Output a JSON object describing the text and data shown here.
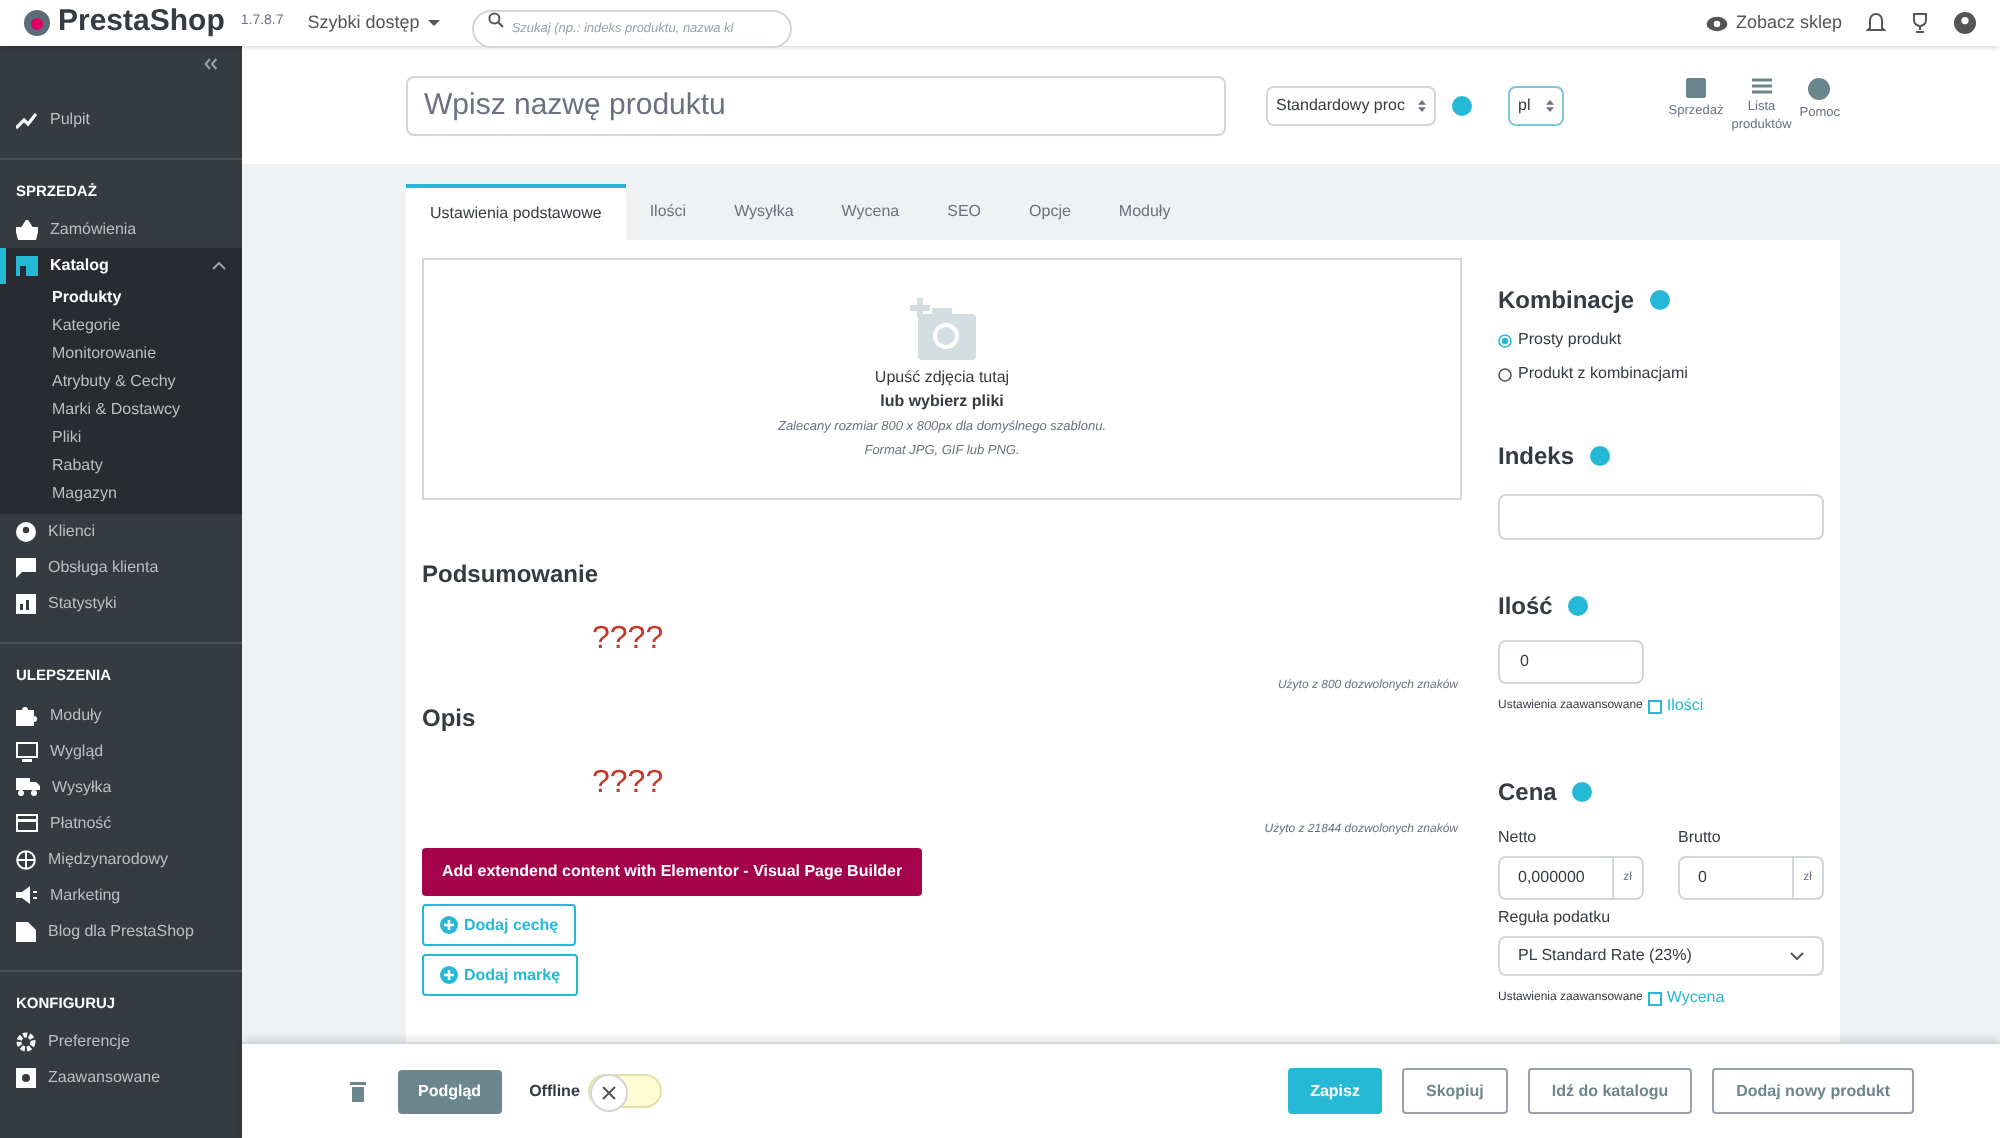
{
  "header": {
    "logo": "PrestaShop",
    "version": "1.7.8.7",
    "quick_access": "Szybki dostęp",
    "search": {
      "placeholder": "Szukaj (np.: indeks produktu, nazwa kl"
    },
    "view_shop": "Zobacz sklep"
  },
  "sidebar": {
    "sections": [
      {
        "items": [
          {
            "label": "Pulpit",
            "selected": false
          }
        ]
      },
      {
        "title": "SPRZEDAŻ",
        "items": [
          {
            "label": "Zamówienia",
            "selected": false
          },
          {
            "label": "Katalog",
            "selected": true,
            "expanded": true,
            "children": [
              {
                "label": "Produkty",
                "selected": true
              },
              {
                "label": "Kategorie",
                "selected": false
              },
              {
                "label": "Monitorowanie",
                "selected": false
              },
              {
                "label": "Atrybuty & Cechy",
                "selected": false
              },
              {
                "label": "Marki & Dostawcy",
                "selected": false
              },
              {
                "label": "Pliki",
                "selected": false
              },
              {
                "label": "Rabaty",
                "selected": false
              },
              {
                "label": "Magazyn",
                "selected": false
              }
            ]
          },
          {
            "label": "Klienci",
            "selected": false
          },
          {
            "label": "Obsługa klienta",
            "selected": false
          },
          {
            "label": "Statystyki",
            "selected": false
          }
        ]
      },
      {
        "title": "ULEPSZENIA",
        "items": [
          {
            "label": "Moduły",
            "selected": false
          },
          {
            "label": "Wygląd",
            "selected": false
          },
          {
            "label": "Wysyłka",
            "selected": false
          },
          {
            "label": "Płatność",
            "selected": false
          },
          {
            "label": "Międzynarodowy",
            "selected": false
          },
          {
            "label": "Marketing",
            "selected": false
          },
          {
            "label": "Blog dla PrestaShop",
            "selected": false
          }
        ]
      },
      {
        "title": "KONFIGURUJ",
        "items": [
          {
            "label": "Preferencje",
            "selected": false
          },
          {
            "label": "Zaawansowane",
            "selected": false
          }
        ]
      }
    ]
  },
  "toolbar": {
    "product_name": {
      "placeholder": "Wpisz nazwę produktu"
    },
    "product_type": "Standardowy proc",
    "language": "pl",
    "actions": [
      "Sprzedaż",
      "Lista produktów",
      "Pomoc"
    ]
  },
  "tabs": [
    {
      "label": "Ustawienia podstawowe",
      "selected": true
    },
    {
      "label": "Ilości",
      "selected": false
    },
    {
      "label": "Wysyłka",
      "selected": false
    },
    {
      "label": "Wycena",
      "selected": false
    },
    {
      "label": "SEO",
      "selected": false
    },
    {
      "label": "Opcje",
      "selected": false
    },
    {
      "label": "Moduły",
      "selected": false
    }
  ],
  "dropzone": {
    "line1": "Upuść zdjęcia tutaj",
    "line2": "lub wybierz pliki",
    "hint1": "Zalecany rozmiar 800 x 800px dla domyślnego szablonu.",
    "hint2": "Format JPG, GIF lub PNG."
  },
  "summary": {
    "title": "Podsumowanie",
    "content": "????",
    "counter": "Użyto z 800 dozwolonych znaków"
  },
  "description": {
    "title": "Opis",
    "content": "????",
    "counter": "Użyto z 21844 dozwolonych znaków"
  },
  "elementor_button": "Add extendend content with Elementor - Visual Page Builder",
  "add_buttons": [
    "Dodaj cechę",
    "Dodaj markę"
  ],
  "combinations": {
    "title": "Kombinacje",
    "options": [
      {
        "label": "Prosty produkt",
        "selected": true
      },
      {
        "label": "Produkt z kombinacjami",
        "selected": false
      }
    ]
  },
  "reference": {
    "title": "Indeks"
  },
  "quantity": {
    "title": "Ilość",
    "value": "0",
    "advanced": "Ustawienia zaawansowane",
    "link": "Ilości"
  },
  "price": {
    "title": "Cena",
    "net": {
      "label": "Netto",
      "value": "0,000000",
      "unit": "zł"
    },
    "gross": {
      "label": "Brutto",
      "value": "0",
      "unit": "zł"
    },
    "tax_label": "Reguła podatku",
    "tax_rule": "PL Standard Rate (23%)",
    "advanced": "Ustawienia zaawansowane",
    "link": "Wycena"
  },
  "footer": {
    "preview": "Podgląd",
    "status_label": "Offline",
    "online": false,
    "buttons": [
      {
        "label": "Zapisz",
        "primary": true
      },
      {
        "label": "Skopiuj",
        "primary": false
      },
      {
        "label": "Idź do katalogu",
        "primary": false
      },
      {
        "label": "Dodaj nowy produkt",
        "primary": false
      }
    ]
  }
}
